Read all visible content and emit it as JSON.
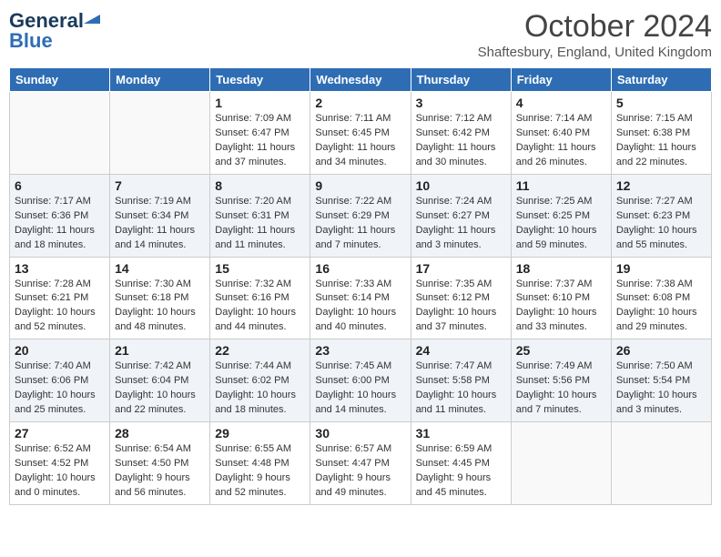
{
  "header": {
    "logo_line1": "General",
    "logo_line2": "Blue",
    "month_title": "October 2024",
    "location": "Shaftesbury, England, United Kingdom"
  },
  "weekdays": [
    "Sunday",
    "Monday",
    "Tuesday",
    "Wednesday",
    "Thursday",
    "Friday",
    "Saturday"
  ],
  "weeks": [
    [
      {
        "day": "",
        "empty": true
      },
      {
        "day": "",
        "empty": true
      },
      {
        "day": "1",
        "sunrise": "Sunrise: 7:09 AM",
        "sunset": "Sunset: 6:47 PM",
        "daylight": "Daylight: 11 hours and 37 minutes."
      },
      {
        "day": "2",
        "sunrise": "Sunrise: 7:11 AM",
        "sunset": "Sunset: 6:45 PM",
        "daylight": "Daylight: 11 hours and 34 minutes."
      },
      {
        "day": "3",
        "sunrise": "Sunrise: 7:12 AM",
        "sunset": "Sunset: 6:42 PM",
        "daylight": "Daylight: 11 hours and 30 minutes."
      },
      {
        "day": "4",
        "sunrise": "Sunrise: 7:14 AM",
        "sunset": "Sunset: 6:40 PM",
        "daylight": "Daylight: 11 hours and 26 minutes."
      },
      {
        "day": "5",
        "sunrise": "Sunrise: 7:15 AM",
        "sunset": "Sunset: 6:38 PM",
        "daylight": "Daylight: 11 hours and 22 minutes."
      }
    ],
    [
      {
        "day": "6",
        "sunrise": "Sunrise: 7:17 AM",
        "sunset": "Sunset: 6:36 PM",
        "daylight": "Daylight: 11 hours and 18 minutes."
      },
      {
        "day": "7",
        "sunrise": "Sunrise: 7:19 AM",
        "sunset": "Sunset: 6:34 PM",
        "daylight": "Daylight: 11 hours and 14 minutes."
      },
      {
        "day": "8",
        "sunrise": "Sunrise: 7:20 AM",
        "sunset": "Sunset: 6:31 PM",
        "daylight": "Daylight: 11 hours and 11 minutes."
      },
      {
        "day": "9",
        "sunrise": "Sunrise: 7:22 AM",
        "sunset": "Sunset: 6:29 PM",
        "daylight": "Daylight: 11 hours and 7 minutes."
      },
      {
        "day": "10",
        "sunrise": "Sunrise: 7:24 AM",
        "sunset": "Sunset: 6:27 PM",
        "daylight": "Daylight: 11 hours and 3 minutes."
      },
      {
        "day": "11",
        "sunrise": "Sunrise: 7:25 AM",
        "sunset": "Sunset: 6:25 PM",
        "daylight": "Daylight: 10 hours and 59 minutes."
      },
      {
        "day": "12",
        "sunrise": "Sunrise: 7:27 AM",
        "sunset": "Sunset: 6:23 PM",
        "daylight": "Daylight: 10 hours and 55 minutes."
      }
    ],
    [
      {
        "day": "13",
        "sunrise": "Sunrise: 7:28 AM",
        "sunset": "Sunset: 6:21 PM",
        "daylight": "Daylight: 10 hours and 52 minutes."
      },
      {
        "day": "14",
        "sunrise": "Sunrise: 7:30 AM",
        "sunset": "Sunset: 6:18 PM",
        "daylight": "Daylight: 10 hours and 48 minutes."
      },
      {
        "day": "15",
        "sunrise": "Sunrise: 7:32 AM",
        "sunset": "Sunset: 6:16 PM",
        "daylight": "Daylight: 10 hours and 44 minutes."
      },
      {
        "day": "16",
        "sunrise": "Sunrise: 7:33 AM",
        "sunset": "Sunset: 6:14 PM",
        "daylight": "Daylight: 10 hours and 40 minutes."
      },
      {
        "day": "17",
        "sunrise": "Sunrise: 7:35 AM",
        "sunset": "Sunset: 6:12 PM",
        "daylight": "Daylight: 10 hours and 37 minutes."
      },
      {
        "day": "18",
        "sunrise": "Sunrise: 7:37 AM",
        "sunset": "Sunset: 6:10 PM",
        "daylight": "Daylight: 10 hours and 33 minutes."
      },
      {
        "day": "19",
        "sunrise": "Sunrise: 7:38 AM",
        "sunset": "Sunset: 6:08 PM",
        "daylight": "Daylight: 10 hours and 29 minutes."
      }
    ],
    [
      {
        "day": "20",
        "sunrise": "Sunrise: 7:40 AM",
        "sunset": "Sunset: 6:06 PM",
        "daylight": "Daylight: 10 hours and 25 minutes."
      },
      {
        "day": "21",
        "sunrise": "Sunrise: 7:42 AM",
        "sunset": "Sunset: 6:04 PM",
        "daylight": "Daylight: 10 hours and 22 minutes."
      },
      {
        "day": "22",
        "sunrise": "Sunrise: 7:44 AM",
        "sunset": "Sunset: 6:02 PM",
        "daylight": "Daylight: 10 hours and 18 minutes."
      },
      {
        "day": "23",
        "sunrise": "Sunrise: 7:45 AM",
        "sunset": "Sunset: 6:00 PM",
        "daylight": "Daylight: 10 hours and 14 minutes."
      },
      {
        "day": "24",
        "sunrise": "Sunrise: 7:47 AM",
        "sunset": "Sunset: 5:58 PM",
        "daylight": "Daylight: 10 hours and 11 minutes."
      },
      {
        "day": "25",
        "sunrise": "Sunrise: 7:49 AM",
        "sunset": "Sunset: 5:56 PM",
        "daylight": "Daylight: 10 hours and 7 minutes."
      },
      {
        "day": "26",
        "sunrise": "Sunrise: 7:50 AM",
        "sunset": "Sunset: 5:54 PM",
        "daylight": "Daylight: 10 hours and 3 minutes."
      }
    ],
    [
      {
        "day": "27",
        "sunrise": "Sunrise: 6:52 AM",
        "sunset": "Sunset: 4:52 PM",
        "daylight": "Daylight: 10 hours and 0 minutes."
      },
      {
        "day": "28",
        "sunrise": "Sunrise: 6:54 AM",
        "sunset": "Sunset: 4:50 PM",
        "daylight": "Daylight: 9 hours and 56 minutes."
      },
      {
        "day": "29",
        "sunrise": "Sunrise: 6:55 AM",
        "sunset": "Sunset: 4:48 PM",
        "daylight": "Daylight: 9 hours and 52 minutes."
      },
      {
        "day": "30",
        "sunrise": "Sunrise: 6:57 AM",
        "sunset": "Sunset: 4:47 PM",
        "daylight": "Daylight: 9 hours and 49 minutes."
      },
      {
        "day": "31",
        "sunrise": "Sunrise: 6:59 AM",
        "sunset": "Sunset: 4:45 PM",
        "daylight": "Daylight: 9 hours and 45 minutes."
      },
      {
        "day": "",
        "empty": true
      },
      {
        "day": "",
        "empty": true
      }
    ]
  ]
}
